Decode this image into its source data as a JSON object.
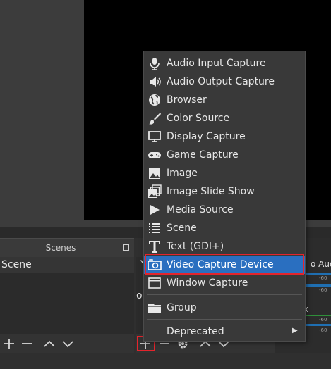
{
  "scenes_dock": {
    "title": "Scenes",
    "items": [
      "Scene"
    ],
    "toolbar": [
      "add-icon",
      "remove-icon",
      "move-up-icon",
      "move-down-icon"
    ]
  },
  "sources_dock": {
    "fragment_1": "Y",
    "fragment_2": "or",
    "toolbar": [
      "add-icon",
      "remove-icon",
      "gear-icon",
      "move-up-icon",
      "move-down-icon"
    ]
  },
  "mixer_dock": {
    "label_1": "o Audi",
    "label_2": "x",
    "tick_1": "-60",
    "tick_2": "-60",
    "tick_3": "-60",
    "tick_4": "-60"
  },
  "source_menu": {
    "items": [
      {
        "label": "Audio Input Capture",
        "icon": "microphone-icon"
      },
      {
        "label": "Audio Output Capture",
        "icon": "speaker-icon"
      },
      {
        "label": "Browser",
        "icon": "globe-icon"
      },
      {
        "label": "Color Source",
        "icon": "brush-icon"
      },
      {
        "label": "Display Capture",
        "icon": "monitor-icon"
      },
      {
        "label": "Game Capture",
        "icon": "gamepad-icon"
      },
      {
        "label": "Image",
        "icon": "image-icon"
      },
      {
        "label": "Image Slide Show",
        "icon": "slideshow-icon"
      },
      {
        "label": "Media Source",
        "icon": "play-icon"
      },
      {
        "label": "Scene",
        "icon": "list-icon"
      },
      {
        "label": "Text (GDI+)",
        "icon": "text-icon"
      },
      {
        "label": "Video Capture Device",
        "icon": "camera-icon",
        "highlighted": true
      },
      {
        "label": "Window Capture",
        "icon": "window-icon"
      },
      {
        "label": "Group",
        "icon": "folder-icon"
      },
      {
        "label": "Deprecated",
        "icon": "",
        "submenu": true
      }
    ]
  },
  "colors": {
    "highlight": "#2a6fc0",
    "annotation_red": "#e4242c",
    "menu_bg": "#393939"
  }
}
